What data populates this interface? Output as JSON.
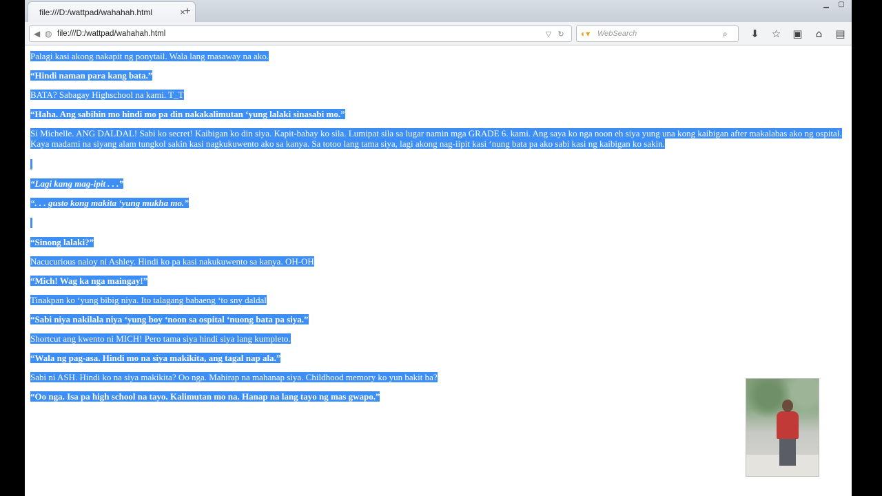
{
  "browser": {
    "tab_title": "file:///D:/wattpad/wahahah.html",
    "tab_close": "×",
    "new_tab": "+",
    "url": "file:///D:/wattpad/wahahah.html",
    "search_placeholder": "WebSearch",
    "icons": [
      "download-icon",
      "star-icon",
      "clipboard-icon",
      "home-icon",
      "gift-icon"
    ]
  },
  "paragraphs": [
    {
      "text": "Palagi kasi akong nakapit ng ponytail. Wala lang masaway na ako.",
      "style": "normal"
    },
    {
      "text": "“Hindi naman para kang bata.”",
      "style": "bold"
    },
    {
      "text": "BATA? Sabagay Highschool na kami. T_T",
      "style": "normal"
    },
    {
      "text": "“Haha. Ang sabihin mo hindi mo pa din nakakalimutan ‘yung lalaki sinasabi mo.”",
      "style": "bold"
    },
    {
      "text": "Si Michelle. ANG DALDAL! Sabi ko secret! Kaibigan ko din siya. Kapit-bahay ko sila. Lumipat sila sa lugar namin mga GRADE 6. kami. Ang saya ko nga noon eh siya yung una kong kaibigan after makalabas ako ng ospital. Kaya madami na siyang alam tungkol sakin kasi nagkukuwento ako sa kanya. Sa totoo lang tama siya, lagi akong nag-iipit kasi ‘nung bata pa ako sabi kasi ng kaibigan ko sakin.",
      "style": "normal"
    },
    {
      "text": "",
      "style": "caret"
    },
    {
      "text": "“Lagi kang mag-ipit . . .”",
      "style": "bolditalic"
    },
    {
      "text": "“. . . gusto kong makita ‘yung mukha mo.”",
      "style": "bolditalic"
    },
    {
      "text": "",
      "style": "caret"
    },
    {
      "text": "“Sinong lalaki?”",
      "style": "bold"
    },
    {
      "text": "Nacucurious naloy ni Ashley. Hindi ko pa kasi nakukuwento sa kanya. OH-OH",
      "style": "normal"
    },
    {
      "text": "“Mich! Wag ka nga maingay!”",
      "style": "bold"
    },
    {
      "text": "Tinakpan ko ‘yung bibig niya. Ito talagang babaeng ‘to sny daldal",
      "style": "normal"
    },
    {
      "text": "“Sabi niya nakilala niya ‘yung boy ‘noon sa ospital ‘nuong bata pa siya.”",
      "style": "bold"
    },
    {
      "text": "Shortcut ang kwento ni MICH! Pero tama siya hindi siya lang kumpleto.",
      "style": "normal"
    },
    {
      "text": "“Wala ng pag-asa. Hindi mo na siya makikita, ang tagal nap ala.”",
      "style": "bold"
    },
    {
      "text": "Sabi ni ASH. Hindi ko na siya makikita? Oo nga. Mahirap na mahanap siya. Childhood memory ko yun bakit ba?",
      "style": "normal"
    },
    {
      "text": "“Oo nga. Isa pa high school na tayo. Kalimutan mo na. Hanap na lang tayo ng mas gwapo.”",
      "style": "bold"
    }
  ]
}
